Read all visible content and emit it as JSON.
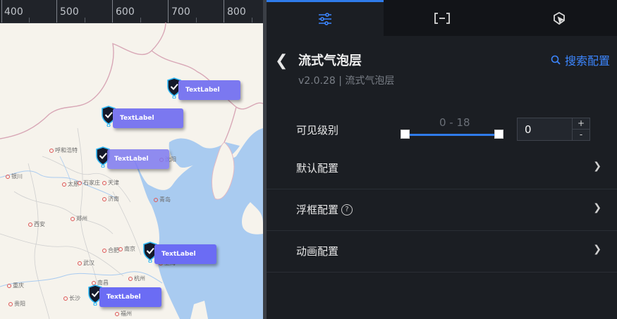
{
  "ruler": {
    "labels": [
      "400",
      "500",
      "600",
      "700",
      "800"
    ]
  },
  "map": {
    "cities": [
      "呼和浩特",
      "银川",
      "太原",
      "石家庄",
      "天津",
      "沈阳",
      "济南",
      "郑州",
      "西安",
      "合肥",
      "南京",
      "武汉",
      "杭州",
      "南昌",
      "长沙",
      "重庆",
      "贵阳",
      "福州",
      "青岛",
      "上海"
    ],
    "bubbles": [
      {
        "label": "TextLabel",
        "color": "#7b78f0"
      },
      {
        "label": "TextLabel",
        "color": "#7b78f0"
      },
      {
        "label": "TextLabel",
        "color": "#8a87f2"
      },
      {
        "label": "TextLabel",
        "color": "#6b6cf4"
      },
      {
        "label": "TextLabel",
        "color": "#6b6cf4"
      }
    ]
  },
  "tabs": [
    {
      "icon": "sliders-icon",
      "active": true
    },
    {
      "icon": "bracket-icon",
      "active": false
    },
    {
      "icon": "interaction-icon",
      "active": false
    }
  ],
  "header": {
    "title": "流式气泡层",
    "subtitle": "v2.0.28 | 流式气泡层",
    "search_label": "搜索配置"
  },
  "visibility": {
    "label": "可见级别",
    "range_text": "0 - 18",
    "min": 0,
    "max": 18,
    "value": "0",
    "plus": "+",
    "minus": "-"
  },
  "sections": [
    {
      "label": "默认配置",
      "help": false
    },
    {
      "label": "浮框配置",
      "help": true
    },
    {
      "label": "动画配置",
      "help": false
    }
  ],
  "colors": {
    "accent": "#2f7bea",
    "panel_bg": "#1b1e23",
    "tab_bg": "#121418"
  }
}
